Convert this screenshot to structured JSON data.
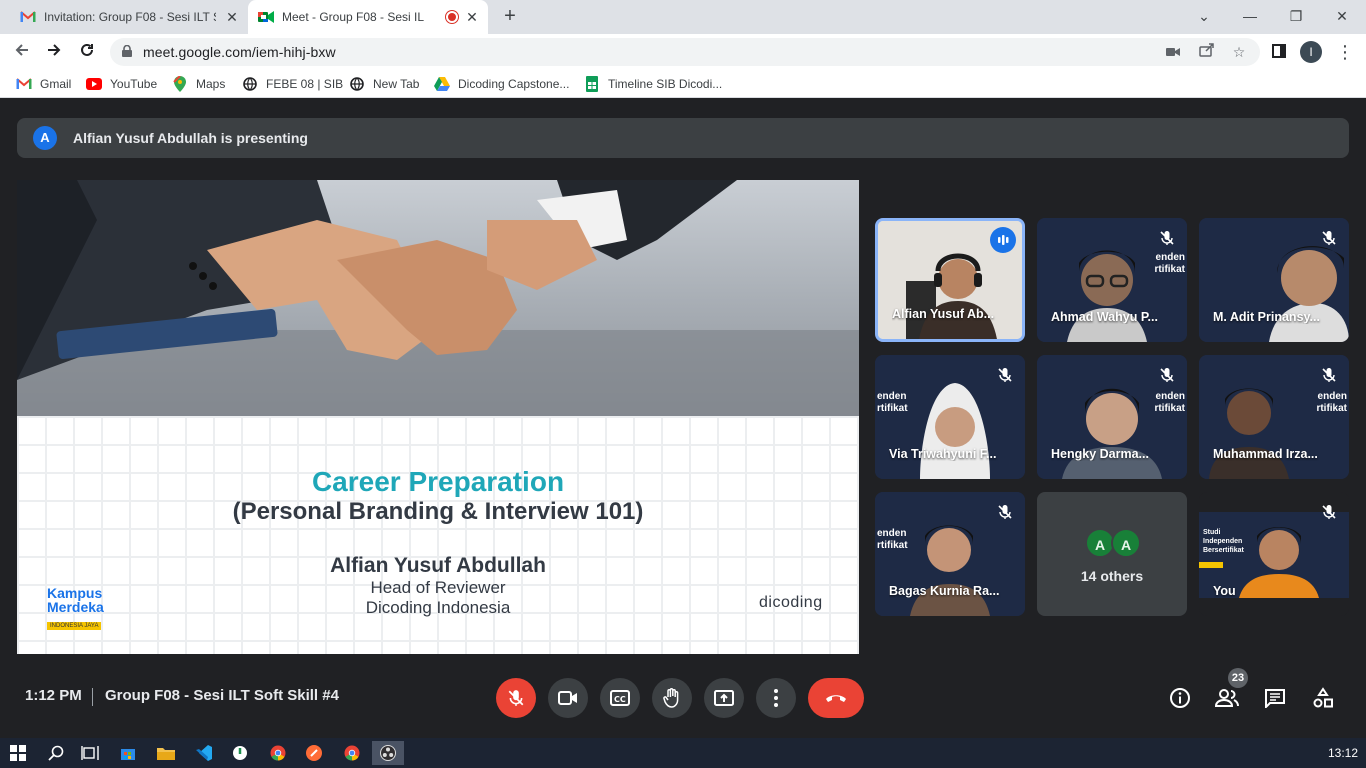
{
  "browser": {
    "tabs": [
      {
        "title": "Invitation: Group F08 - Sesi ILT So",
        "icon": "gmail-icon"
      },
      {
        "title": "Meet - Group F08 - Sesi IL",
        "icon": "meet-icon",
        "recording": true
      }
    ],
    "url": "meet.google.com/iem-hihj-bxw",
    "profile_initial": "I",
    "bookmarks": [
      {
        "label": "Gmail",
        "icon": "gmail-icon"
      },
      {
        "label": "YouTube",
        "icon": "youtube-icon"
      },
      {
        "label": "Maps",
        "icon": "maps-icon"
      },
      {
        "label": "FEBE 08 | SIB",
        "icon": "globe-icon"
      },
      {
        "label": "New Tab",
        "icon": "globe-icon"
      },
      {
        "label": "Dicoding Capstone...",
        "icon": "drive-icon"
      },
      {
        "label": "Timeline SIB Dicodi...",
        "icon": "sheets-icon"
      }
    ]
  },
  "meet": {
    "presenter_initial": "A",
    "presenting_text": "Alfian Yusuf Abdullah is presenting",
    "slide": {
      "title": "Career Preparation",
      "subtitle": "(Personal Branding & Interview 101)",
      "speaker": "Alfian Yusuf Abdullah",
      "role": "Head of Reviewer",
      "org": "Dicoding Indonesia",
      "logo_left_1": "Kampus",
      "logo_left_2": "Merdeka",
      "logo_left_3": "INDONESIA JAYA",
      "logo_right": "dicoding"
    },
    "participants": [
      {
        "name": "Alfian Yusuf Ab...",
        "speaking": true
      },
      {
        "name": "Ahmad Wahyu P...",
        "muted": true
      },
      {
        "name": "M. Adit Prinansy...",
        "muted": true
      },
      {
        "name": "Via Triwahyuni F...",
        "muted": true
      },
      {
        "name": "Hengky Darma...",
        "muted": true
      },
      {
        "name": "Muhammad Irza...",
        "muted": true
      },
      {
        "name": "Bagas Kurnia Ra...",
        "muted": true
      },
      {
        "name": "You",
        "muted": true
      }
    ],
    "others": {
      "avatars": [
        "A",
        "A"
      ],
      "label": "14 others"
    },
    "bg_text": {
      "a": "enden",
      "b": "rtifikat",
      "c": "Studi",
      "d": "Independen",
      "e": "Bersertifikat"
    },
    "time": "1:12 PM",
    "meeting_name": "Group F08 - Sesi ILT Soft Skill #4",
    "people_count": "23"
  },
  "taskbar": {
    "clock": "13:12"
  },
  "colors": {
    "accent": "#1a73e8",
    "danger": "#ea4335",
    "slide_title": "#1fa7b8"
  }
}
